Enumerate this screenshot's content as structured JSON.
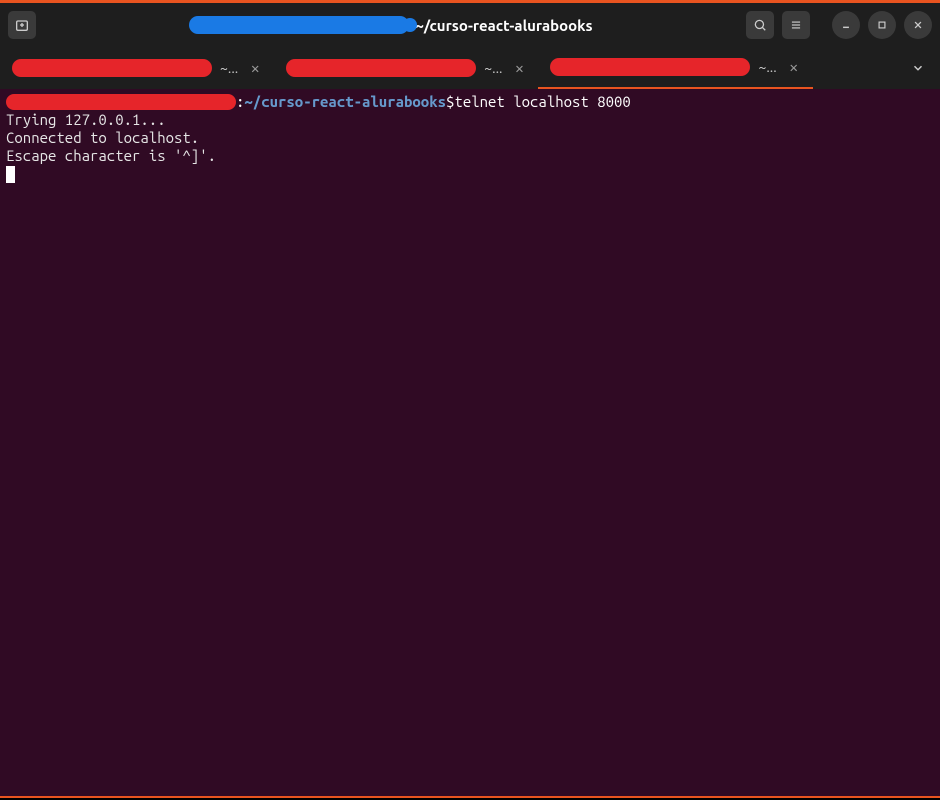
{
  "window": {
    "titleSuffix": "~/curso-react-alurabooks"
  },
  "tabs": [
    {
      "labelSuffix": "~..."
    },
    {
      "labelSuffix": "~..."
    },
    {
      "labelSuffix": "~..."
    }
  ],
  "terminal": {
    "promptColon": ":",
    "promptPath": "~/curso-react-alurabooks",
    "promptSymbol": "$",
    "command": " telnet localhost 8000",
    "lines": [
      "Trying 127.0.0.1...",
      "Connected to localhost.",
      "Escape character is '^]'."
    ]
  }
}
